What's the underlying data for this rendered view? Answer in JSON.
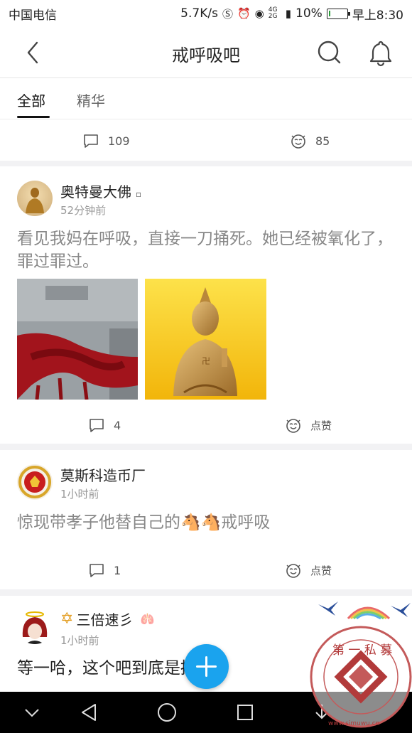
{
  "status_bar": {
    "carrier": "中国电信",
    "speed": "5.7K/s",
    "network": "4G 2G",
    "battery": "10%",
    "time": "早上8:30",
    "battery_level": 0.1
  },
  "header": {
    "title": "戒呼吸吧"
  },
  "tabs": [
    {
      "label": "全部"
    },
    {
      "label": "精华"
    }
  ],
  "posts": [
    {
      "comments": "109",
      "likes": "85"
    },
    {
      "username": "奥特曼大佛",
      "time": "52分钟前",
      "text": "看见我妈在呼吸，直接一刀捅死。她已经被氧化了，罪过罪过。",
      "comments": "4",
      "likes": "点赞"
    },
    {
      "username": "莫斯科造币厂",
      "time": "1小时前",
      "text": "惊现带孝子他替自己的🐴🐴戒呼吸",
      "comments": "1",
      "likes": "点赞"
    },
    {
      "username": "三倍速彡",
      "time": "1小时前",
      "text": "等一哈，这个吧到底是搞啥的"
    }
  ],
  "watermark": {
    "text": "第 一 私 募",
    "url": "www.simuwu.cn"
  },
  "colors": {
    "accent": "#1aa3ee",
    "text_primary": "#222222",
    "text_secondary": "#888888"
  }
}
